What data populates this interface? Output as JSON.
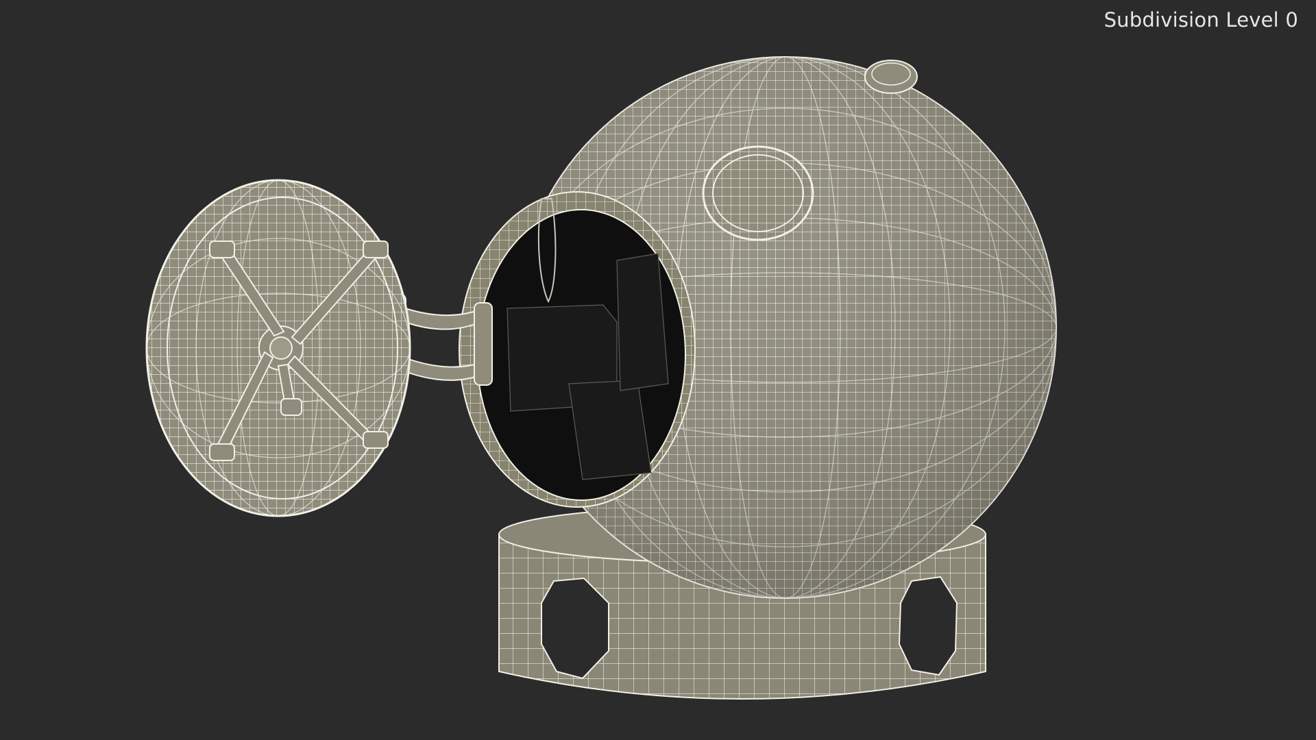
{
  "viewport": {
    "overlay_label": "Subdivision Level 0",
    "background_color": "#2b2b2b"
  },
  "model": {
    "surface_color": "#8f8c7c",
    "wire_color": "#f2f0e6",
    "interior_color": "#0f0f0f"
  }
}
